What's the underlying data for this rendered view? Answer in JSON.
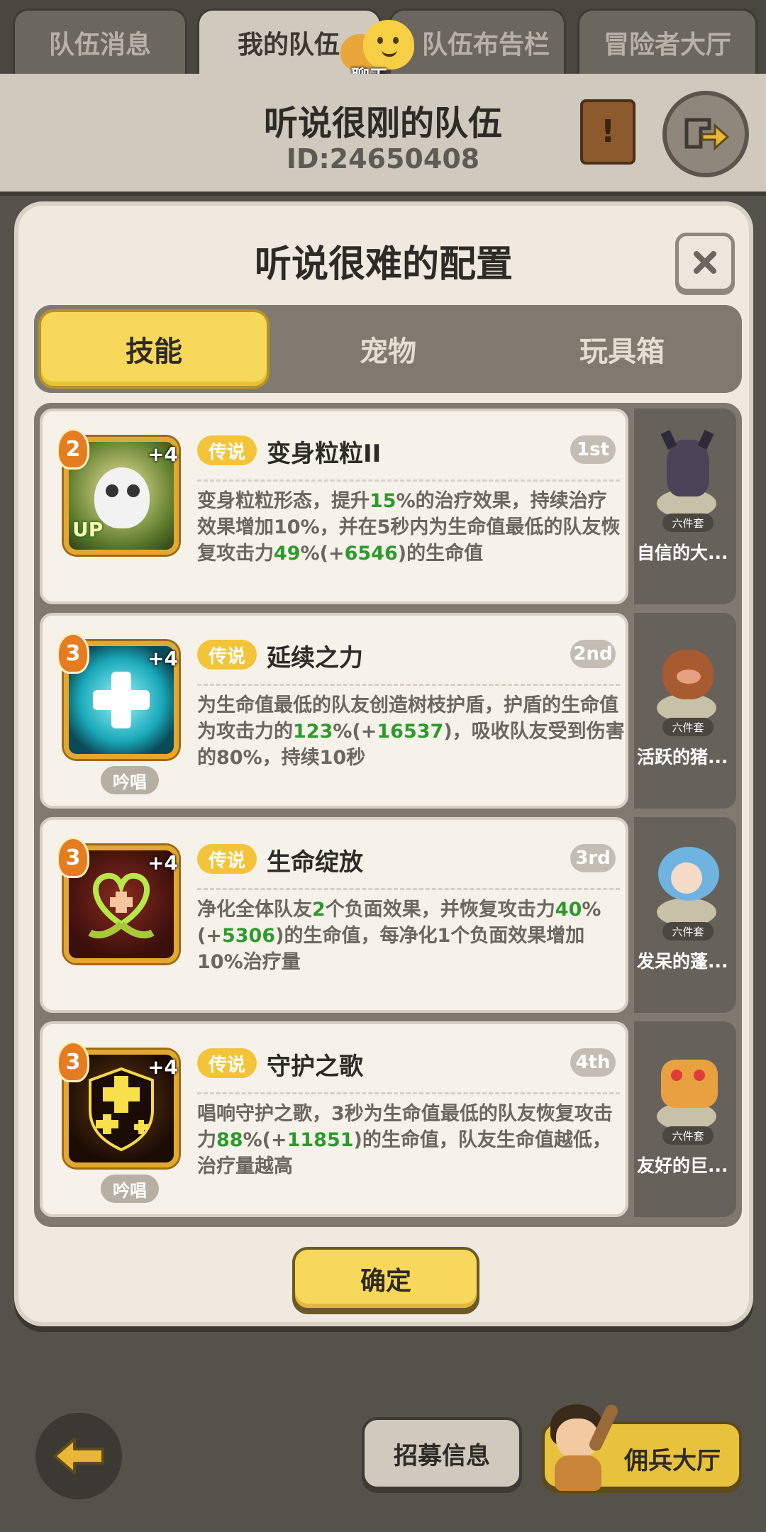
{
  "top_tabs": [
    {
      "label": "队伍消息"
    },
    {
      "label": "我的队伍"
    },
    {
      "label": "队伍布告栏"
    },
    {
      "label": "冒险者大厅"
    }
  ],
  "chat": {
    "label": "聊天"
  },
  "team": {
    "name": "听说很刚的队伍",
    "id": "ID:24650408"
  },
  "modal": {
    "title": "听说很难的配置",
    "segments": [
      {
        "label": "技能"
      },
      {
        "label": "宠物"
      },
      {
        "label": "玩具箱"
      }
    ],
    "confirm_label": "确定"
  },
  "skills": [
    {
      "level": "2",
      "plus": "+4",
      "badge": "UP",
      "tag": "",
      "rarity": "传说",
      "name": "变身粒粒II",
      "rank": "1st",
      "desc_parts": [
        "变身粒粒形态，提升",
        "15",
        "%的治疗效果，持续治疗效果增加10%，并在5秒内为生命值最低的队友恢复攻击力",
        "49",
        "%(+",
        "6546",
        ")的生命值"
      ],
      "mount": {
        "set": "六件套",
        "name": "自信的大..."
      }
    },
    {
      "level": "3",
      "plus": "+4",
      "badge": "",
      "tag": "吟唱",
      "rarity": "传说",
      "name": "延续之力",
      "rank": "2nd",
      "desc_parts": [
        "为生命值最低的队友创造树枝护盾，护盾的生命值为攻击力的",
        "123",
        "%(+",
        "16537",
        ")，吸收队友受到伤害的80%，持续10秒"
      ],
      "mount": {
        "set": "六件套",
        "name": "活跃的猪..."
      }
    },
    {
      "level": "3",
      "plus": "+4",
      "badge": "",
      "tag": "",
      "rarity": "传说",
      "name": "生命绽放",
      "rank": "3rd",
      "desc_parts": [
        "净化全体队友",
        "2",
        "个负面效果，并恢复攻击力",
        "40",
        "%(+",
        "5306",
        ")的生命值，每净化1个负面效果增加10%治疗量"
      ],
      "mount": {
        "set": "六件套",
        "name": "发呆的蓬..."
      }
    },
    {
      "level": "3",
      "plus": "+4",
      "badge": "",
      "tag": "吟唱",
      "rarity": "传说",
      "name": "守护之歌",
      "rank": "4th",
      "desc_parts": [
        "唱响守护之歌，3秒为生命值最低的队友恢复攻击力",
        "88",
        "%(+",
        "11851",
        ")的生命值，队友生命值越低，治疗量越高"
      ],
      "mount": {
        "set": "六件套",
        "name": "友好的巨..."
      }
    }
  ],
  "bottom": {
    "recruit_label": "招募信息",
    "mercenary_label": "佣兵大厅"
  },
  "colors": {
    "accent_yellow": "#f7d85a",
    "highlight_green": "#2d9a2d",
    "panel": "#efe9df",
    "frame": "#7f796f"
  }
}
